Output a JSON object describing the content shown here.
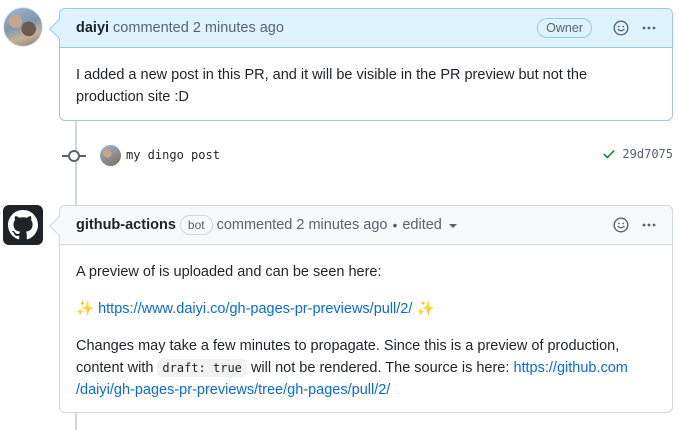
{
  "comment1": {
    "author": "daiyi",
    "action": "commented 2 minutes ago",
    "role_badge": "Owner",
    "body": "I added a new post in this PR, and it will be visible in the PR preview but not the production site :D"
  },
  "commit": {
    "message": "my dingo post",
    "sha": "29d7075",
    "status_icon": "check-icon"
  },
  "comment2": {
    "author": "github-actions",
    "bot_badge": "bot",
    "action": "commented 2 minutes ago",
    "separator": "•",
    "edited_label": "edited",
    "para1": "A preview of is uploaded and can be seen here:",
    "sparkle": "✨",
    "preview_link": "https://www.daiyi.co/gh-pages-pr-previews/pull/2/",
    "para3_a": "Changes may take a few minutes to propagate. Since this is a preview of production, content with",
    "para3_code": "draft: true",
    "para3_b": "will not be rendered. The source is here:",
    "source_link_1": "https://github.com",
    "source_link_2": "/daiyi/gh-pages-pr-previews/tree/gh-pages/pull/2/"
  },
  "colors": {
    "owner_header_bg": "#ddf4ff",
    "owner_border": "#9cc5f5",
    "link": "#0969da",
    "success": "#1a7f37"
  }
}
